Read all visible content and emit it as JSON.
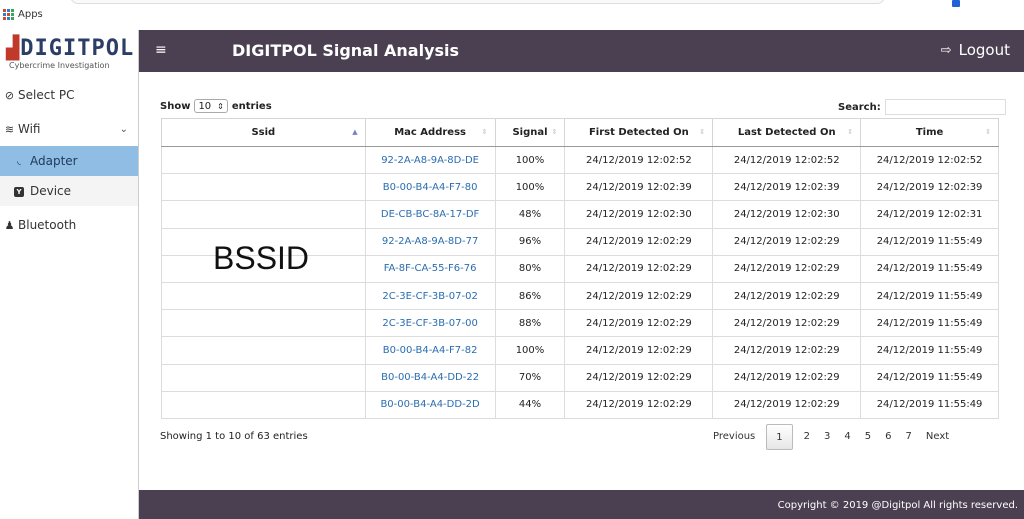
{
  "browser": {
    "apps_label": "Apps"
  },
  "sidebar": {
    "logo_text": "DIGITPOL",
    "logo_tagline": "Cybercrime Investigation",
    "items": [
      {
        "label": "Select PC",
        "icon": "check-circle-icon"
      },
      {
        "label": "Wifi",
        "icon": "wifi-icon",
        "expanded": true,
        "children": [
          {
            "label": "Adapter",
            "icon": "rss-icon",
            "active": true
          },
          {
            "label": "Device",
            "icon": "device-icon"
          }
        ]
      },
      {
        "label": "Bluetooth",
        "icon": "bell-icon"
      }
    ]
  },
  "header": {
    "menu_icon": "≡",
    "title": "DIGITPOL Signal Analysis",
    "logout_label": "Logout"
  },
  "table_controls": {
    "show_label": "Show",
    "length_value": "10",
    "entries_label": "entries",
    "search_label": "Search:"
  },
  "table": {
    "columns": [
      "Ssid",
      "Mac Address",
      "Signal",
      "First Detected On",
      "Last Detected On",
      "Time"
    ],
    "rows": [
      {
        "ssid": "",
        "mac": "92-2A-A8-9A-8D-DE",
        "signal": "100%",
        "first": "24/12/2019 12:02:52",
        "last": "24/12/2019 12:02:52",
        "time": "24/12/2019 12:02:52"
      },
      {
        "ssid": "",
        "mac": "B0-00-B4-A4-F7-80",
        "signal": "100%",
        "first": "24/12/2019 12:02:39",
        "last": "24/12/2019 12:02:39",
        "time": "24/12/2019 12:02:39"
      },
      {
        "ssid": "",
        "mac": "DE-CB-BC-8A-17-DF",
        "signal": "48%",
        "first": "24/12/2019 12:02:30",
        "last": "24/12/2019 12:02:30",
        "time": "24/12/2019 12:02:31"
      },
      {
        "ssid": "",
        "mac": "92-2A-A8-9A-8D-77",
        "signal": "96%",
        "first": "24/12/2019 12:02:29",
        "last": "24/12/2019 12:02:29",
        "time": "24/12/2019 11:55:49"
      },
      {
        "ssid": "",
        "mac": "FA-8F-CA-55-F6-76",
        "signal": "80%",
        "first": "24/12/2019 12:02:29",
        "last": "24/12/2019 12:02:29",
        "time": "24/12/2019 11:55:49"
      },
      {
        "ssid": "",
        "mac": "2C-3E-CF-3B-07-02",
        "signal": "86%",
        "first": "24/12/2019 12:02:29",
        "last": "24/12/2019 12:02:29",
        "time": "24/12/2019 11:55:49"
      },
      {
        "ssid": "",
        "mac": "2C-3E-CF-3B-07-00",
        "signal": "88%",
        "first": "24/12/2019 12:02:29",
        "last": "24/12/2019 12:02:29",
        "time": "24/12/2019 11:55:49"
      },
      {
        "ssid": "",
        "mac": "B0-00-B4-A4-F7-82",
        "signal": "100%",
        "first": "24/12/2019 12:02:29",
        "last": "24/12/2019 12:02:29",
        "time": "24/12/2019 11:55:49"
      },
      {
        "ssid": "",
        "mac": "B0-00-B4-A4-DD-22",
        "signal": "70%",
        "first": "24/12/2019 12:02:29",
        "last": "24/12/2019 12:02:29",
        "time": "24/12/2019 11:55:49"
      },
      {
        "ssid": "",
        "mac": "B0-00-B4-A4-DD-2D",
        "signal": "44%",
        "first": "24/12/2019 12:02:29",
        "last": "24/12/2019 12:02:29",
        "time": "24/12/2019 11:55:49"
      }
    ],
    "overlay_text": "BSSID"
  },
  "pagination": {
    "info": "Showing 1 to 10 of 63 entries",
    "previous": "Previous",
    "pages": [
      "1",
      "2",
      "3",
      "4",
      "5",
      "6",
      "7"
    ],
    "current": "1",
    "next": "Next"
  },
  "footer": {
    "copyright": "Copyright © 2019 @Digitpol All rights reserved."
  },
  "colors": {
    "header_bg": "#4b4052",
    "active_item_bg": "#8fbde3",
    "link": "#2a6db0"
  }
}
